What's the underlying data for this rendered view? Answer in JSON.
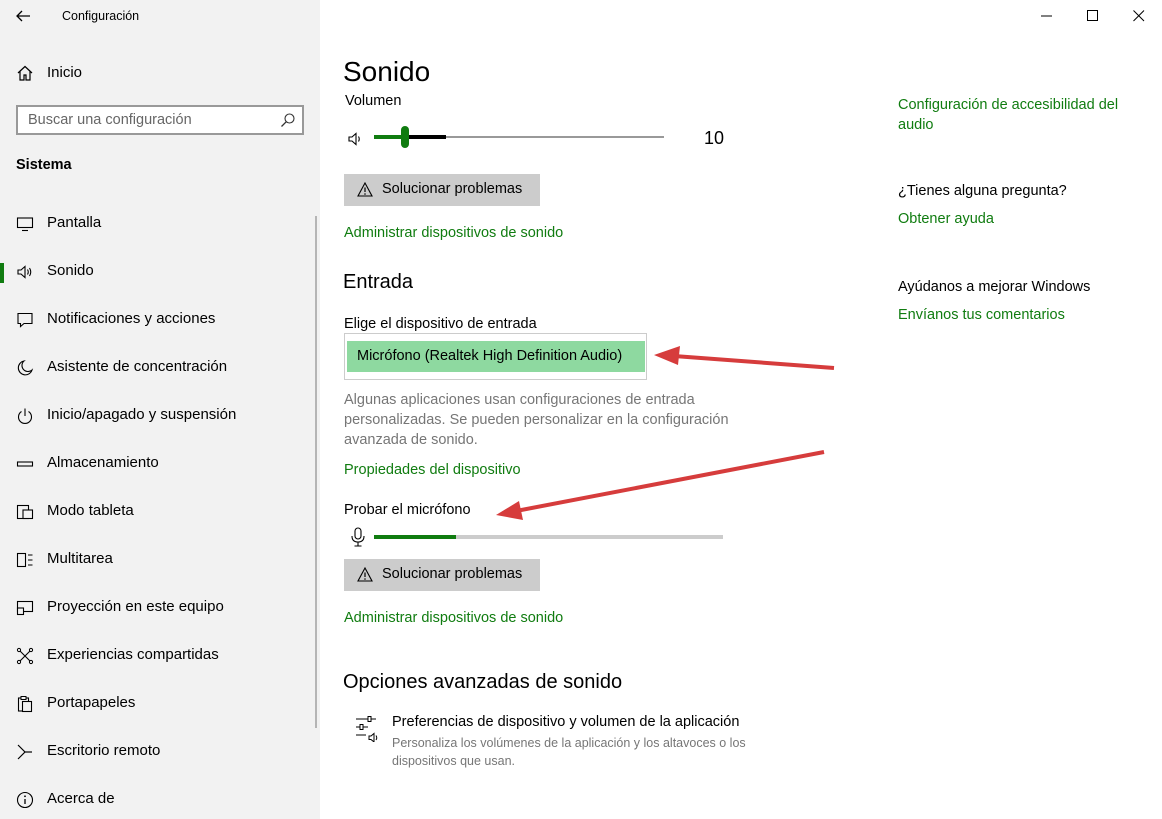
{
  "window": {
    "title": "Configuración",
    "controls": [
      "minimize-icon",
      "maximize-icon",
      "close-icon"
    ]
  },
  "sidebar": {
    "home_label": "Inicio",
    "search_placeholder": "Buscar una configuración",
    "section": "Sistema",
    "items": [
      {
        "label": "Pantalla",
        "icon": "monitor-icon"
      },
      {
        "label": "Sonido",
        "icon": "speaker-icon",
        "selected": true
      },
      {
        "label": "Notificaciones y acciones",
        "icon": "notification-icon"
      },
      {
        "label": "Asistente de concentración",
        "icon": "moon-icon"
      },
      {
        "label": "Inicio/apagado y suspensión",
        "icon": "power-icon"
      },
      {
        "label": "Almacenamiento",
        "icon": "storage-icon"
      },
      {
        "label": "Modo tableta",
        "icon": "tablet-icon"
      },
      {
        "label": "Multitarea",
        "icon": "multitask-icon"
      },
      {
        "label": "Proyección en este equipo",
        "icon": "projection-icon"
      },
      {
        "label": "Experiencias compartidas",
        "icon": "shared-icon"
      },
      {
        "label": "Portapapeles",
        "icon": "clipboard-icon"
      },
      {
        "label": "Escritorio remoto",
        "icon": "remote-desktop-icon"
      },
      {
        "label": "Acerca de",
        "icon": "info-icon"
      }
    ]
  },
  "main": {
    "title": "Sonido",
    "volume_label": "Volumen",
    "volume_value": "10",
    "volume_level": 0.1,
    "troubleshoot_label": "Solucionar problemas",
    "manage_devices_link": "Administrar dispositivos de sonido",
    "input_heading": "Entrada",
    "choose_input_label": "Elige el dispositivo de entrada",
    "selected_input_device": "Micrófono (Realtek High Definition Audio)",
    "input_note": [
      "Algunas aplicaciones usan configuraciones de entrada",
      "personalizadas. Se pueden personalizar en la configuración",
      "avanzada de sonido."
    ],
    "device_properties_link": "Propiedades del dispositivo",
    "test_mic_label": "Probar el micrófono",
    "mic_level": 0.235,
    "troubleshoot_label_2": "Solucionar problemas",
    "manage_devices_link_2": "Administrar dispositivos de sonido",
    "advanced_heading": "Opciones avanzadas de sonido",
    "app_prefs_title": "Preferencias de dispositivo y volumen de la aplicación",
    "app_prefs_desc": [
      "Personaliza los volúmenes de la aplicación y los altavoces o los",
      "dispositivos que usan."
    ]
  },
  "right_panel": {
    "accessibility_link": [
      "Configuración de accesibilidad del",
      "audio"
    ],
    "question_heading": "¿Tienes alguna pregunta?",
    "help_link": "Obtener ayuda",
    "improve_heading": "Ayúdanos a mejorar Windows",
    "feedback_link": "Envíanos tus comentarios"
  },
  "colors": {
    "accent": "#107c10",
    "selected_device_bg": "#8ed9a0",
    "annotation_arrow": "#d63c3c"
  }
}
